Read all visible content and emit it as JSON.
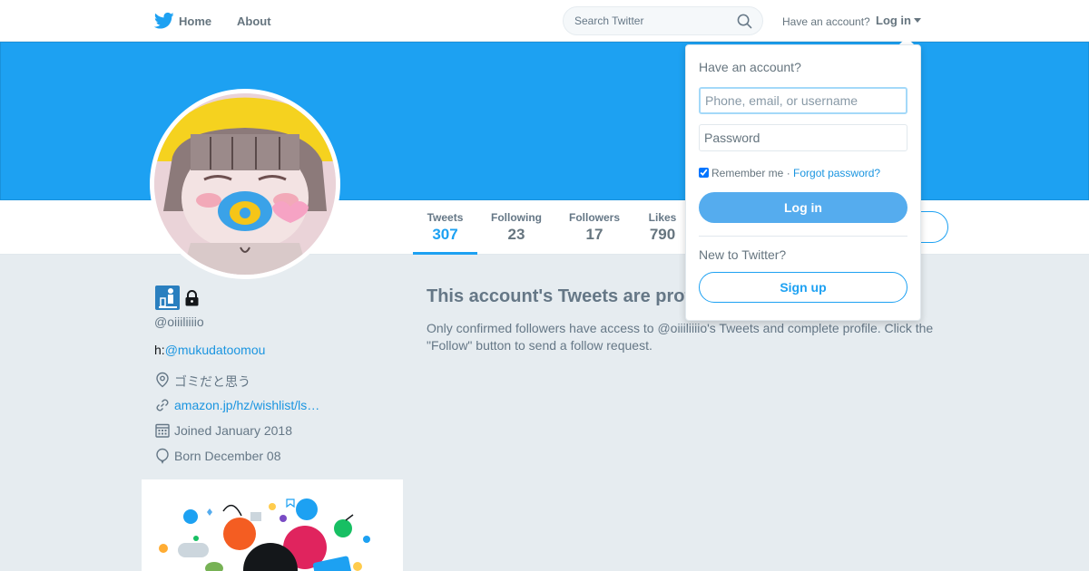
{
  "nav": {
    "logo_icon": "twitter-bird-icon",
    "home_label": "Home",
    "about_label": "About",
    "search_placeholder": "Search Twitter",
    "search_icon": "search-icon",
    "have_account_label": "Have an account?",
    "login_label": "Log in"
  },
  "colors": {
    "brand_blue": "#1da1f2",
    "link_blue": "#1b95e0",
    "background": "#e6ecf0",
    "muted_text": "#657786"
  },
  "profile_nav": {
    "stats": [
      {
        "label": "Tweets",
        "value": "307",
        "active": true
      },
      {
        "label": "Following",
        "value": "23"
      },
      {
        "label": "Followers",
        "value": "17"
      },
      {
        "label": "Likes",
        "value": "790"
      }
    ]
  },
  "profile": {
    "screen_name": "@oiiiliiiio",
    "bio_prefix": "h:",
    "bio_mention": "@mukudatoomou",
    "location": "ゴミだと思う",
    "url": "amazon.jp/hz/wishlist/ls…",
    "joined": "Joined January 2018",
    "born": "Born December 08",
    "location_icon": "location-pin-icon",
    "url_icon": "link-icon",
    "joined_icon": "calendar-icon",
    "born_icon": "balloon-icon",
    "badge_icon": "custom-badge-icon",
    "lock_icon": "lock-icon"
  },
  "main": {
    "protected_title": "This account's Tweets are protected.",
    "protected_desc": "Only confirmed followers have access to @oiiiliiiio's Tweets and complete profile. Click the \"Follow\" button to send a follow request."
  },
  "login_dropdown": {
    "heading": "Have an account?",
    "username_placeholder": "Phone, email, or username",
    "password_placeholder": "Password",
    "remember_label": "Remember me",
    "separator": "·",
    "forgot_label": "Forgot password?",
    "login_button": "Log in",
    "new_label": "New to Twitter?",
    "signup_button": "Sign up"
  }
}
